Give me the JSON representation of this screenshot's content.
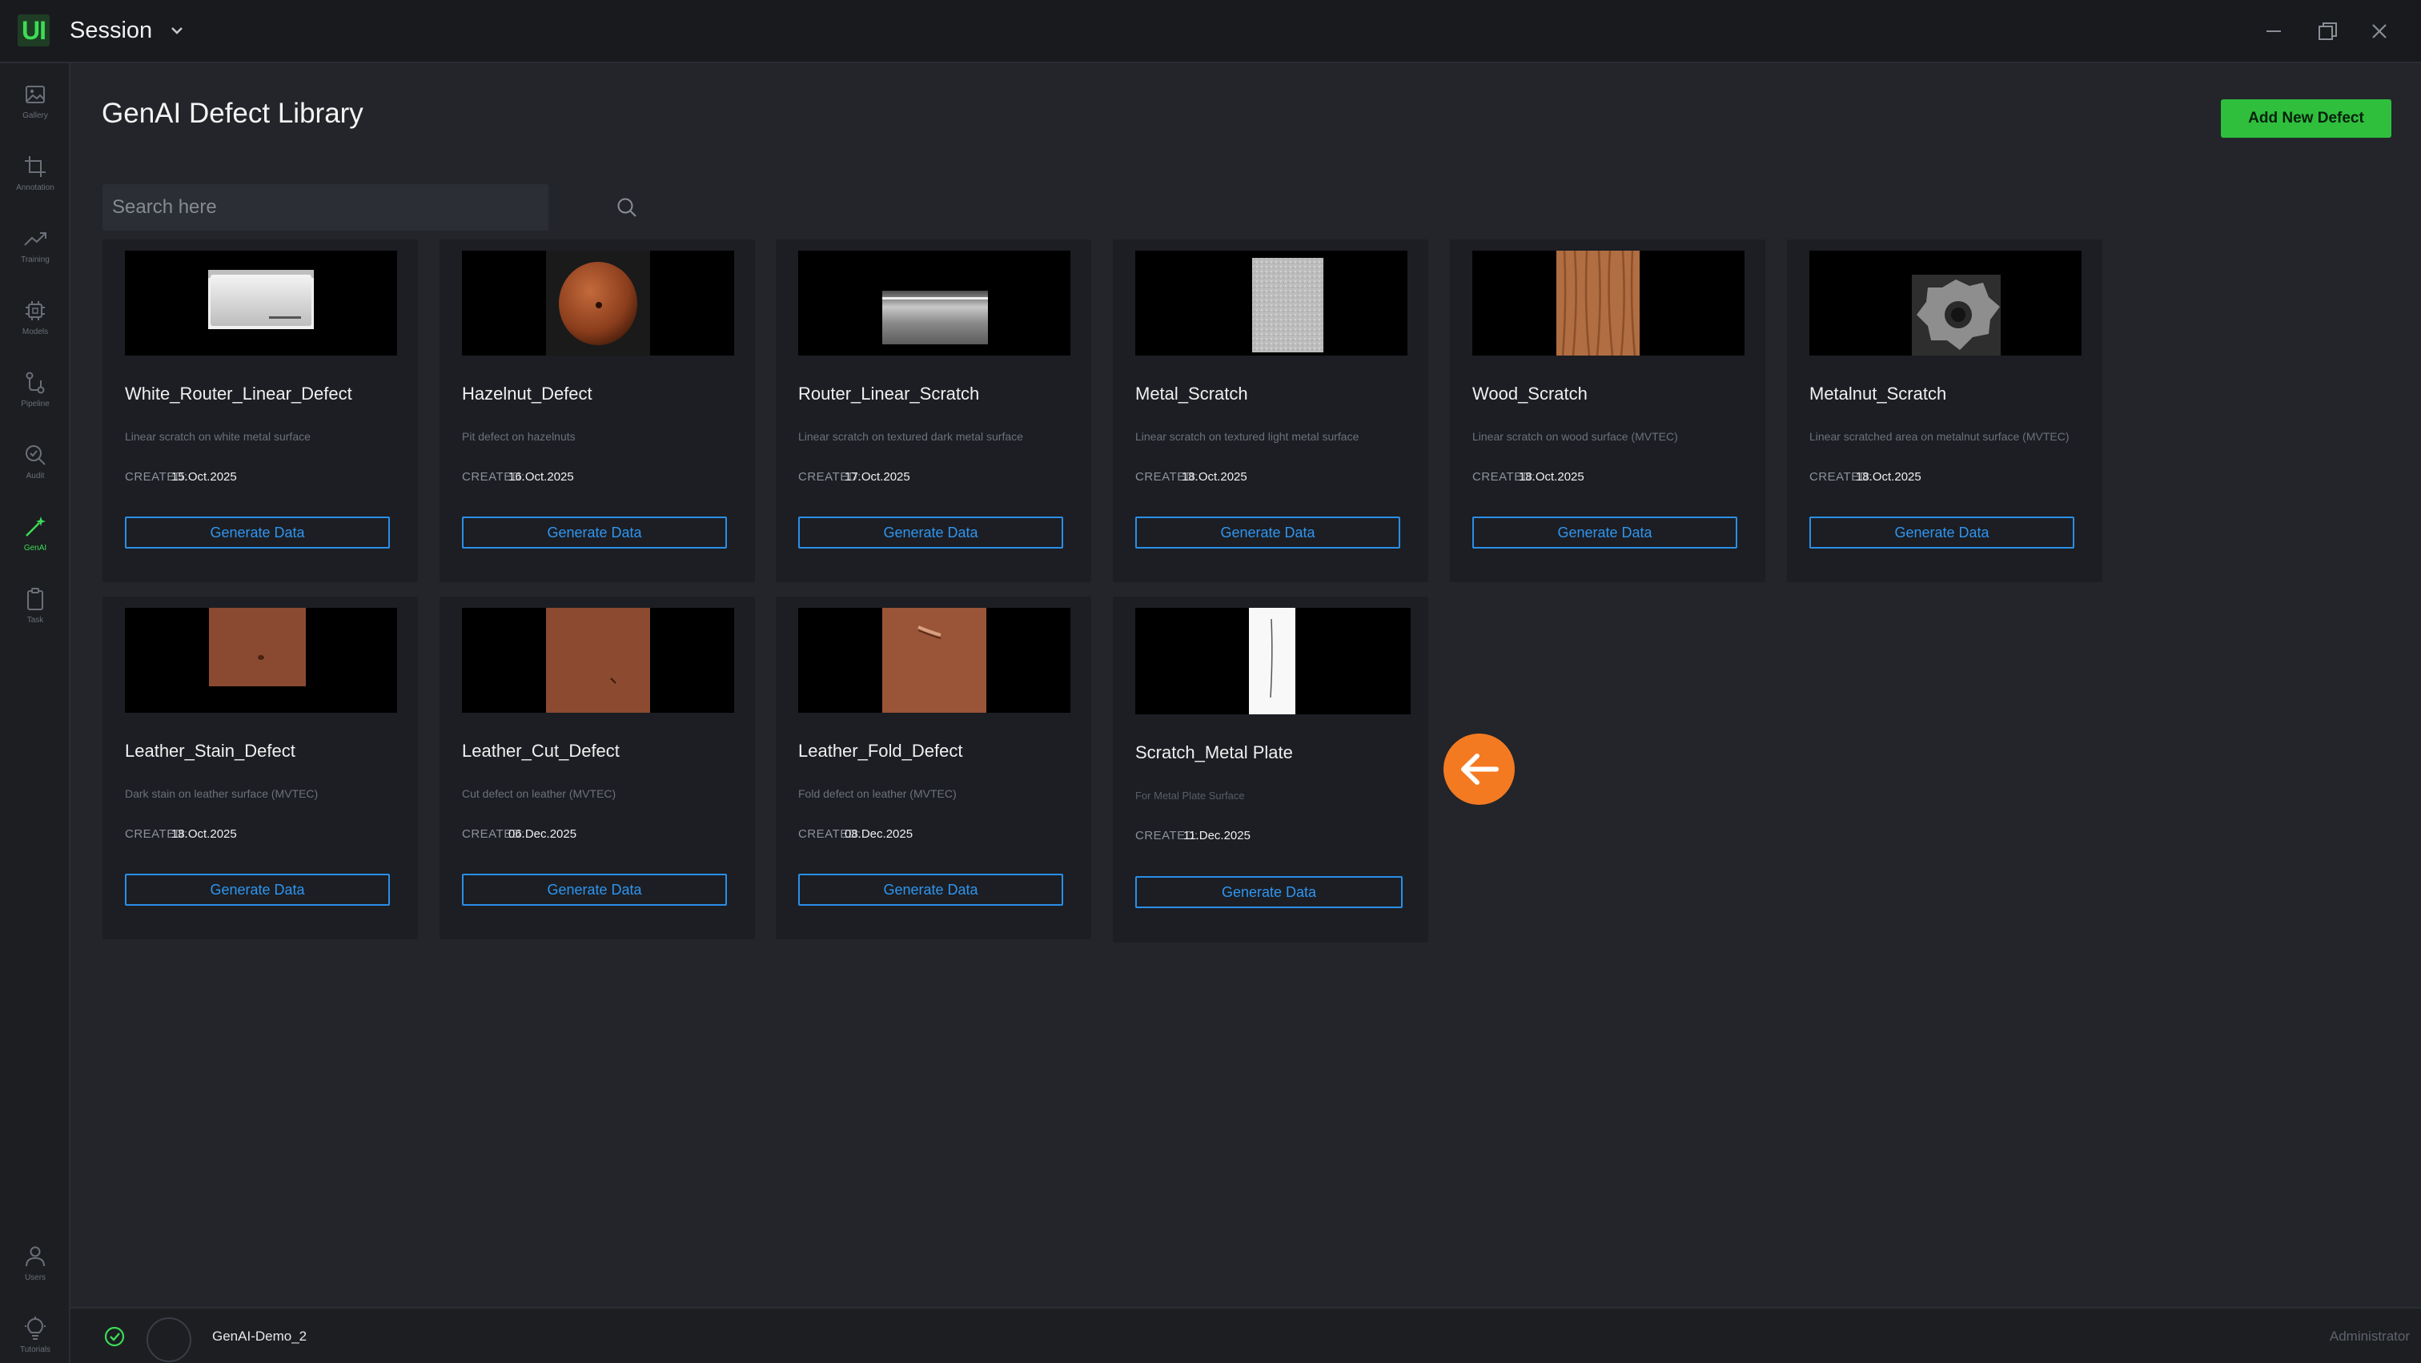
{
  "app": {
    "logo": "UI",
    "session_label": "Session"
  },
  "colors": {
    "accent_green": "#2fbf3d",
    "accent_blue": "#2a8fe8",
    "fab_orange": "#f47a22",
    "background": "#23252a"
  },
  "sidebar": {
    "items": [
      {
        "label": "Gallery",
        "icon": "image-icon"
      },
      {
        "label": "Annotation",
        "icon": "crop-icon"
      },
      {
        "label": "Training",
        "icon": "trend-icon"
      },
      {
        "label": "Models",
        "icon": "chip-icon"
      },
      {
        "label": "Pipeline",
        "icon": "pipeline-icon"
      },
      {
        "label": "Audit",
        "icon": "audit-icon"
      },
      {
        "label": "GenAI",
        "icon": "wand-icon",
        "active": true
      },
      {
        "label": "Task",
        "icon": "clipboard-icon"
      }
    ],
    "bottom_items": [
      {
        "label": "Users",
        "icon": "user-icon"
      },
      {
        "label": "Tutorials",
        "icon": "bulb-icon"
      }
    ]
  },
  "header": {
    "title": "GenAI Defect Library",
    "add_button": "Add New Defect"
  },
  "search": {
    "placeholder": "Search here"
  },
  "cards": [
    {
      "name": "White_Router_Linear_Defect",
      "description": "Linear scratch on white metal surface",
      "created_label": "CREATED:",
      "created": "15.Oct.2025",
      "button": "Generate Data",
      "thumb": "white-router"
    },
    {
      "name": "Hazelnut_Defect",
      "description": "Pit defect on hazelnuts",
      "created_label": "CREATED:",
      "created": "16.Oct.2025",
      "button": "Generate Data",
      "thumb": "hazelnut"
    },
    {
      "name": "Router_Linear_Scratch",
      "description": "Linear scratch on textured dark metal surface",
      "created_label": "CREATED:",
      "created": "17.Oct.2025",
      "button": "Generate Data",
      "thumb": "router-dark"
    },
    {
      "name": "Metal_Scratch",
      "description": "Linear scratch on textured light metal surface",
      "created_label": "CREATED:",
      "created": "18.Oct.2025",
      "button": "Generate Data",
      "thumb": "metal"
    },
    {
      "name": "Wood_Scratch",
      "description": "Linear scratch on wood surface (MVTEC)",
      "created_label": "CREATED:",
      "created": "18.Oct.2025",
      "button": "Generate Data",
      "thumb": "wood"
    },
    {
      "name": "Metalnut_Scratch",
      "description": "Linear scratched area on metalnut surface (MVTEC)",
      "created_label": "CREATED:",
      "created": "18.Oct.2025",
      "button": "Generate Data",
      "thumb": "metalnut"
    },
    {
      "name": "Leather_Stain_Defect",
      "description": "Dark stain on leather surface (MVTEC)",
      "created_label": "CREATED:",
      "created": "18.Oct.2025",
      "button": "Generate Data",
      "thumb": "leather"
    },
    {
      "name": "Leather_Cut_Defect",
      "description": "Cut defect on leather (MVTEC)",
      "created_label": "CREATED:",
      "created": "06.Dec.2025",
      "button": "Generate Data",
      "thumb": "leather"
    },
    {
      "name": "Leather_Fold_Defect",
      "description": "Fold defect on leather (MVTEC)",
      "created_label": "CREATED:",
      "created": "08.Dec.2025",
      "button": "Generate Data",
      "thumb": "leather-fold"
    },
    {
      "name": "Scratch_Metal Plate",
      "description": "For Metal Plate Surface",
      "created_label": "CREATED:",
      "created": "11.Dec.2025",
      "button": "Generate Data",
      "thumb": "metal-plate"
    }
  ],
  "status": {
    "project": "GenAI-Demo_2",
    "user": "Administrator"
  }
}
